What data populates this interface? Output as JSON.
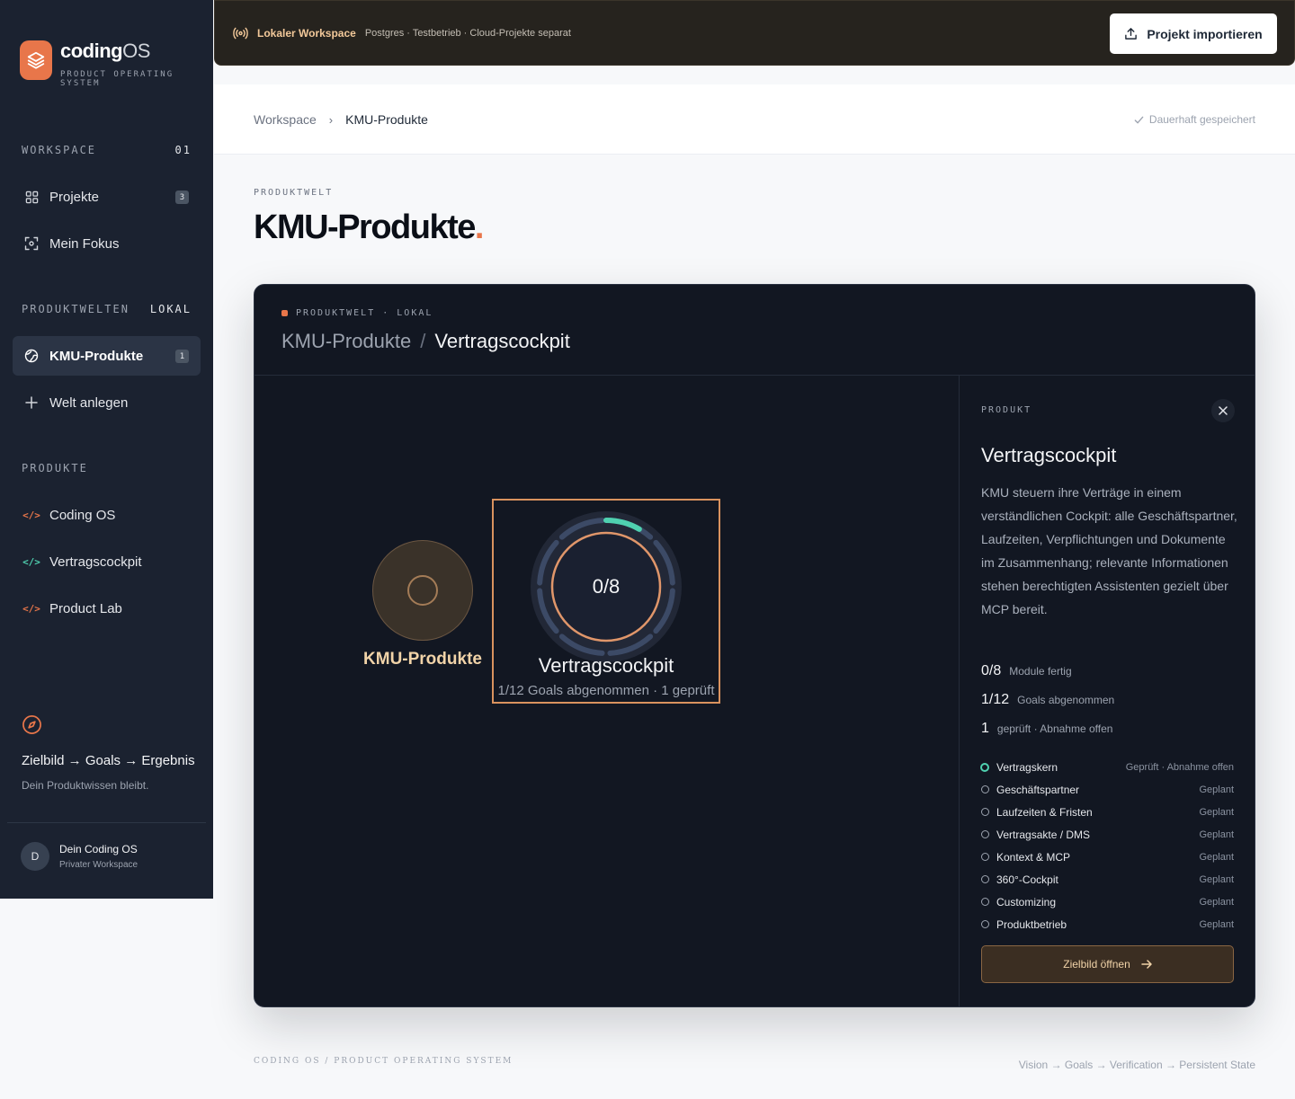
{
  "brand": {
    "name": "coding",
    "name_suffix": "OS",
    "tagline": "PRODUCT OPERATING SYSTEM",
    "logo_color": "#e8764a"
  },
  "sidebar": {
    "workspace": {
      "label": "WORKSPACE",
      "count": "01",
      "items": [
        {
          "label": "Projekte",
          "badge": "3",
          "icon": "grid-icon"
        },
        {
          "label": "Mein Fokus",
          "icon": "focus-icon"
        }
      ]
    },
    "worlds": {
      "label": "PRODUKTWELTEN",
      "tag": "LOKAL",
      "items": [
        {
          "label": "KMU-Produkte",
          "badge": "1",
          "icon": "globe-icon",
          "active": true
        }
      ],
      "add_label": "Welt anlegen"
    },
    "products": {
      "label": "PRODUKTE",
      "items": [
        {
          "label": "Coding OS",
          "icon": "code-icon",
          "color": "#e8764a"
        },
        {
          "label": "Vertragscockpit",
          "icon": "code-icon",
          "color": "#4fd1b0"
        },
        {
          "label": "Product Lab",
          "icon": "code-icon",
          "color": "#e8764a"
        }
      ]
    },
    "vision": {
      "title": "Zielbild → Goals → Ergebnis",
      "subtitle": "Dein Produktwissen bleibt.",
      "icon": "compass-icon"
    },
    "user": {
      "initial": "D",
      "name": "Dein Coding OS",
      "subtitle": "Privater Workspace"
    }
  },
  "topbar": {
    "title": "Lokaler Workspace",
    "subtitle": "Postgres · Testbetrieb · Cloud-Projekte separat",
    "import_label": "Projekt importieren"
  },
  "breadcrumb": {
    "root": "Workspace",
    "separator": "›",
    "current": "KMU-Produkte",
    "saved_label": "Dauerhaft gespeichert"
  },
  "page": {
    "eyebrow": "PRODUKTWELT",
    "title": "KMU-Produkte",
    "title_dot": "."
  },
  "card": {
    "eyebrow": "PRODUKTWELT · LOKAL",
    "title_parent": "KMU-Produkte",
    "title_sep": "/",
    "title_current": "Vertragscockpit"
  },
  "graph": {
    "world_node": {
      "label": "KMU-Produkte"
    },
    "product_node": {
      "count": "0/8",
      "label": "Vertragscockpit",
      "sub": "1/12 Goals abgenommen · 1 geprüft",
      "progress_fraction": 0.083
    }
  },
  "panel": {
    "eyebrow": "PRODUKT",
    "title": "Vertragscockpit",
    "description": "KMU steuern ihre Verträge in einem verständlichen Cockpit: alle Geschäftspartner, Laufzeiten, Verpflichtungen und Dokumente im Zusammenhang; relevante Informationen stehen berechtigten Assistenten gezielt über MCP bereit.",
    "stats": [
      {
        "value": "0/8",
        "label": "Module fertig"
      },
      {
        "value": "1/12",
        "label": "Goals abgenommen"
      },
      {
        "value": "1",
        "label": "geprüft · Abnahme offen"
      }
    ],
    "modules": [
      {
        "name": "Vertragskern",
        "status": "Geprüft · Abnahme offen"
      },
      {
        "name": "Geschäftspartner",
        "status": "Geplant"
      },
      {
        "name": "Laufzeiten & Fristen",
        "status": "Geplant"
      },
      {
        "name": "Vertragsakte / DMS",
        "status": "Geplant"
      },
      {
        "name": "Kontext & MCP",
        "status": "Geplant"
      },
      {
        "name": "360°-Cockpit",
        "status": "Geplant"
      },
      {
        "name": "Customizing",
        "status": "Geplant"
      },
      {
        "name": "Produktbetrieb",
        "status": "Geplant"
      }
    ],
    "open_label": "Zielbild öffnen"
  },
  "footer": {
    "left": "CODING OS / PRODUCT OPERATING SYSTEM",
    "right": "Vision → Goals → Verification → Persistent State"
  },
  "colors": {
    "accent": "#e8764a",
    "teal": "#4fd1b0",
    "sidebar_bg": "#1b2230",
    "card_bg": "#121722"
  }
}
